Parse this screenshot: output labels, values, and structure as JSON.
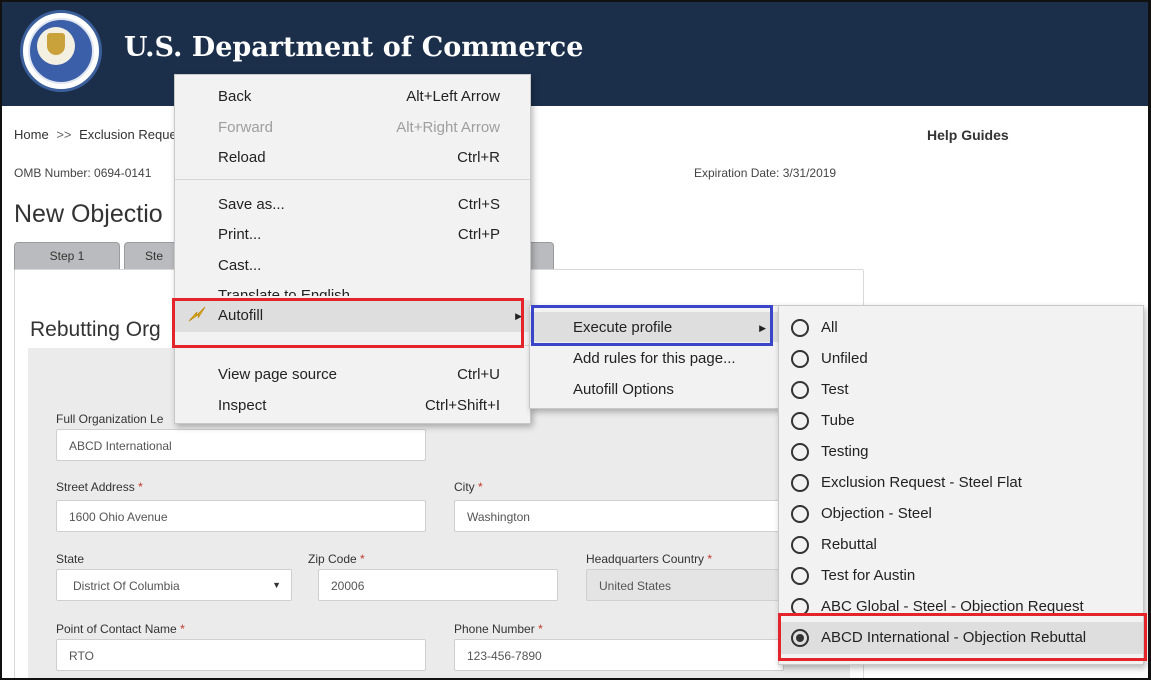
{
  "site": {
    "title": "U.S. Department of Commerce",
    "seal_alt": "Department of Commerce United States of America"
  },
  "breadcrumb": {
    "home": "Home",
    "separator": ">>",
    "current": "Exclusion Reque"
  },
  "help_link": "Help Guides",
  "omb_number": "OMB Number: 0694-0141",
  "expiration": "Expiration Date: 3/31/2019",
  "page_title": "New Objectio",
  "tabs": [
    {
      "label": "Step 1"
    },
    {
      "label": "Ste"
    },
    {
      "label": ""
    }
  ],
  "section_title": "Rebutting Org",
  "form": {
    "org_label": "Full Organization Le",
    "org_value": "ABCD International",
    "street_label": "Street Address",
    "street_value": "1600 Ohio Avenue",
    "city_label": "City",
    "city_value": "Washington",
    "state_label": "State",
    "state_value": "District Of Columbia",
    "zip_label": "Zip Code",
    "zip_value": "20006",
    "country_label": "Headquarters Country",
    "country_value": "United States",
    "poc_label": "Point of Contact Name",
    "poc_value": "RTO",
    "phone_label": "Phone Number",
    "phone_value": "123-456-7890",
    "required_mark": "*"
  },
  "context_menu": {
    "back": {
      "label": "Back",
      "shortcut": "Alt+Left Arrow"
    },
    "forward": {
      "label": "Forward",
      "shortcut": "Alt+Right Arrow"
    },
    "reload": {
      "label": "Reload",
      "shortcut": "Ctrl+R"
    },
    "save_as": {
      "label": "Save as...",
      "shortcut": "Ctrl+S"
    },
    "print": {
      "label": "Print...",
      "shortcut": "Ctrl+P"
    },
    "cast": {
      "label": "Cast..."
    },
    "translate": {
      "label": "Translate to English"
    },
    "autofill": {
      "label": "Autofill"
    },
    "view_source": {
      "label": "View page source",
      "shortcut": "Ctrl+U"
    },
    "inspect": {
      "label": "Inspect",
      "shortcut": "Ctrl+Shift+I"
    }
  },
  "autofill_menu": {
    "execute_profile": "Execute profile",
    "add_rules": "Add rules for this page...",
    "options": "Autofill Options"
  },
  "profiles": [
    {
      "label": "All",
      "selected": false
    },
    {
      "label": "Unfiled",
      "selected": false
    },
    {
      "label": "Test",
      "selected": false
    },
    {
      "label": "Tube",
      "selected": false
    },
    {
      "label": "Testing",
      "selected": false
    },
    {
      "label": "Exclusion Request - Steel Flat",
      "selected": false
    },
    {
      "label": "Objection - Steel",
      "selected": false
    },
    {
      "label": "Rebuttal",
      "selected": false
    },
    {
      "label": "Test for Austin",
      "selected": false
    },
    {
      "label": "ABC Global - Steel - Objection Request",
      "selected": false
    },
    {
      "label": "ABCD International - Objection Rebuttal",
      "selected": true
    }
  ],
  "colors": {
    "header_bg": "#1b2f4b",
    "highlight_red": "#e3242b",
    "highlight_blue": "#3a44c9"
  }
}
